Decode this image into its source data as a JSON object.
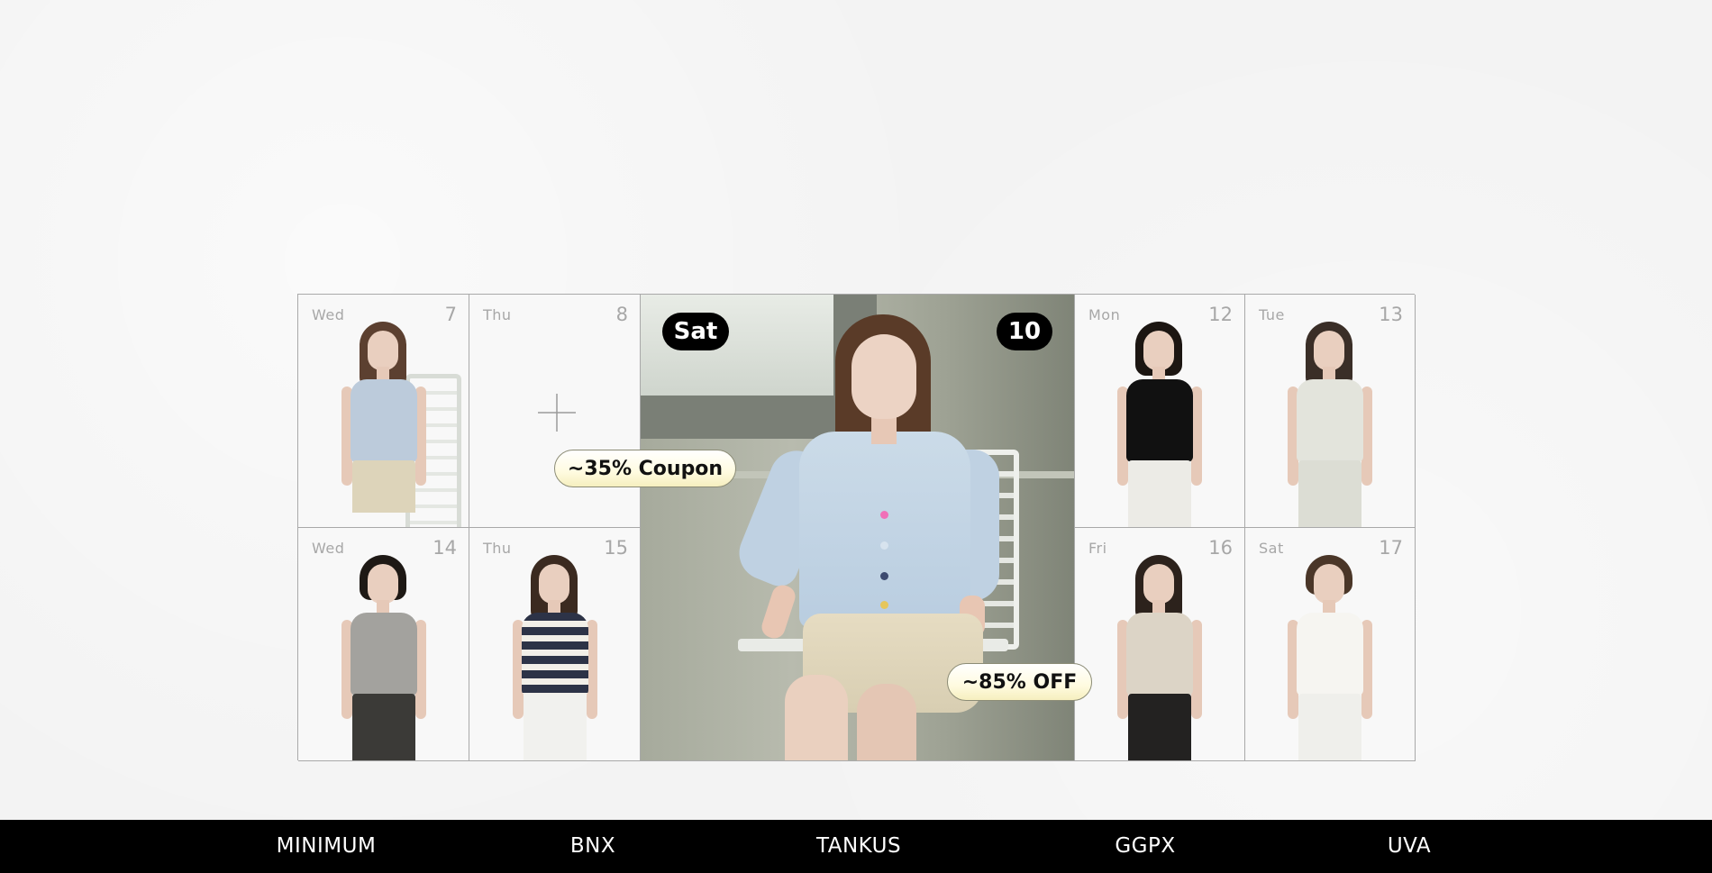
{
  "calendar": {
    "cells": [
      {
        "weekday": "Wed",
        "day": "7"
      },
      {
        "weekday": "Thu",
        "day": "8"
      },
      {
        "weekday": "Mon",
        "day": "12"
      },
      {
        "weekday": "Tue",
        "day": "13"
      },
      {
        "weekday": "Wed",
        "day": "14"
      },
      {
        "weekday": "Thu",
        "day": "15"
      },
      {
        "weekday": "Fri",
        "day": "16"
      },
      {
        "weekday": "Sat",
        "day": "17"
      }
    ],
    "featured": {
      "weekday": "Sat",
      "day": "10"
    }
  },
  "promos": {
    "coupon": "~35% Coupon",
    "discount": "~85% OFF"
  },
  "brands": [
    "MINIMUM",
    "BNX",
    "TANKUS",
    "GGPX",
    "UVA"
  ],
  "icons": {
    "add": "plus-icon"
  },
  "colors": {
    "brand_bar": "#000000",
    "pill": "#000000",
    "promo_fill": "#fffbe0",
    "grid_line": "#a9a9a9"
  }
}
